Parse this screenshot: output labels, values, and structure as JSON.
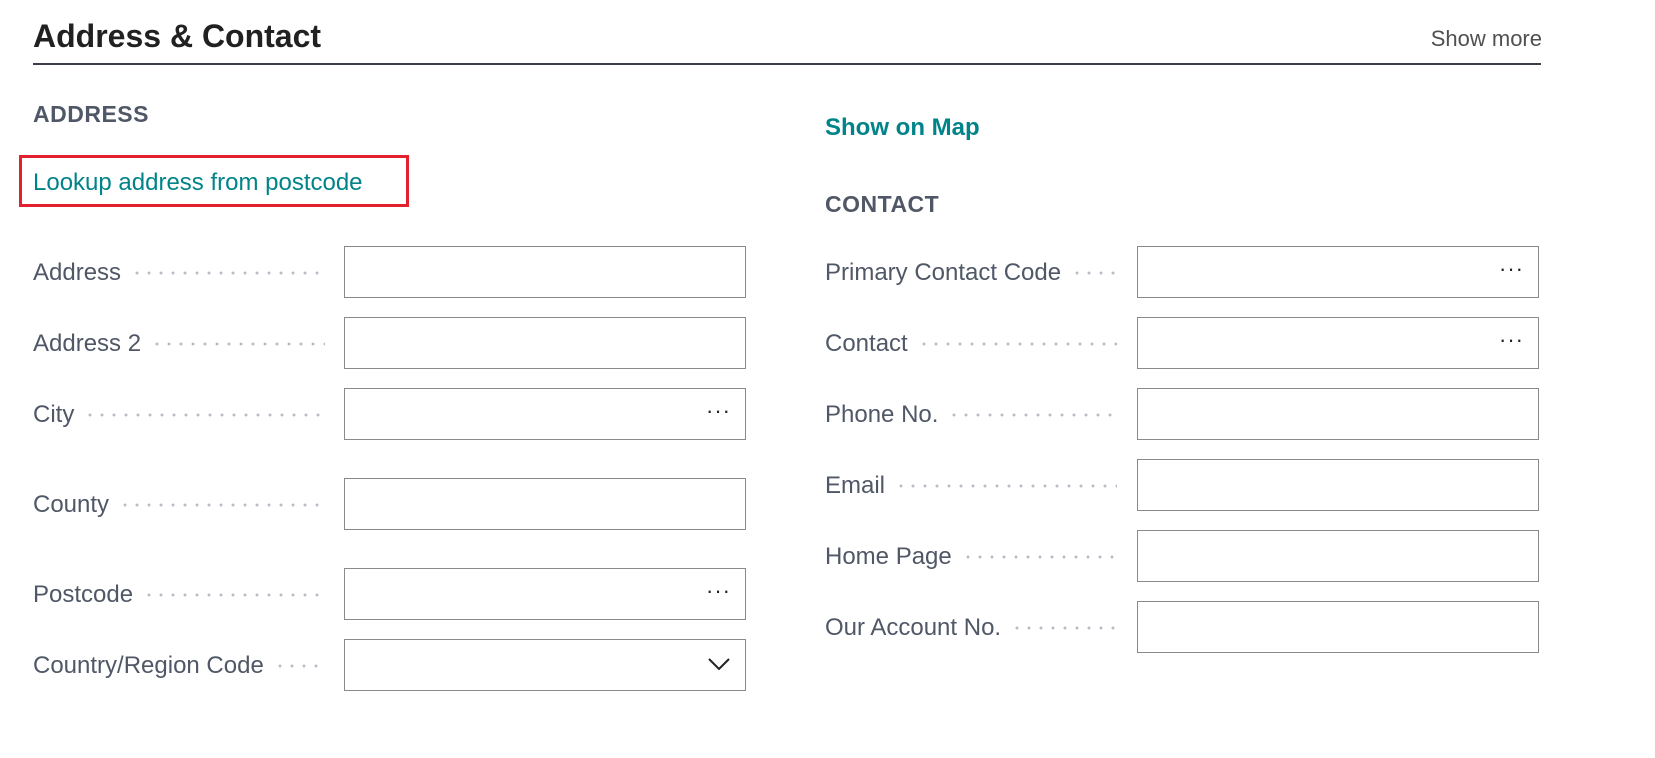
{
  "header": {
    "title": "Address & Contact",
    "show_more": "Show more"
  },
  "address": {
    "group_title": "ADDRESS",
    "lookup_link": "Lookup address from postcode",
    "fields": {
      "address": "Address",
      "address2": "Address 2",
      "city": "City",
      "county": "County",
      "postcode": "Postcode",
      "country": "Country/Region Code"
    }
  },
  "contact": {
    "show_on_map": "Show on Map",
    "group_title": "CONTACT",
    "fields": {
      "primary_contact_code": "Primary Contact Code",
      "contact": "Contact",
      "phone": "Phone No.",
      "email": "Email",
      "home_page": "Home Page",
      "our_account_no": "Our Account No."
    }
  },
  "icons": {
    "ellipsis": "ellipsis-icon",
    "chevron": "chevron-down-icon"
  },
  "ellipsis_glyph": "···"
}
